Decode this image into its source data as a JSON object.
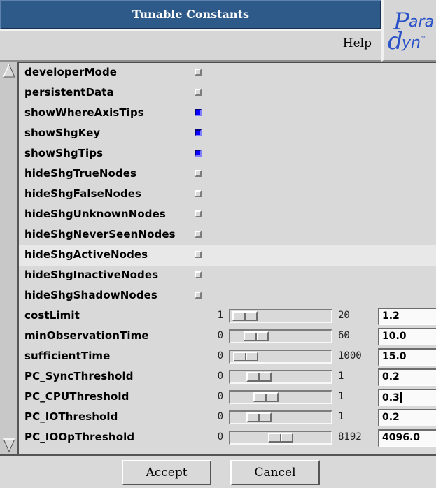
{
  "window": {
    "title": "Tunable Constants"
  },
  "menu": {
    "help_label": "Help"
  },
  "logo": {
    "text_top": "Para",
    "text_bottom": "dyn"
  },
  "booleans": [
    {
      "name": "developerMode",
      "checked": false
    },
    {
      "name": "persistentData",
      "checked": false
    },
    {
      "name": "showWhereAxisTips",
      "checked": true
    },
    {
      "name": "showShgKey",
      "checked": true
    },
    {
      "name": "showShgTips",
      "checked": true
    },
    {
      "name": "hideShgTrueNodes",
      "checked": false
    },
    {
      "name": "hideShgFalseNodes",
      "checked": false
    },
    {
      "name": "hideShgUnknownNodes",
      "checked": false
    },
    {
      "name": "hideShgNeverSeenNodes",
      "checked": false
    },
    {
      "name": "hideShgActiveNodes",
      "checked": false,
      "highlighted": true
    },
    {
      "name": "hideShgInactiveNodes",
      "checked": false
    },
    {
      "name": "hideShgShadowNodes",
      "checked": false
    }
  ],
  "floats": [
    {
      "name": "costLimit",
      "min": "1",
      "max": "20",
      "value": "1.2"
    },
    {
      "name": "minObservationTime",
      "min": "0",
      "max": "60",
      "value": "10.0"
    },
    {
      "name": "sufficientTime",
      "min": "0",
      "max": "1000",
      "value": "15.0"
    },
    {
      "name": "PC_SyncThreshold",
      "min": "0",
      "max": "1",
      "value": "0.2"
    },
    {
      "name": "PC_CPUThreshold",
      "min": "0",
      "max": "1",
      "value": "0.3",
      "focused": true
    },
    {
      "name": "PC_IOThreshold",
      "min": "0",
      "max": "1",
      "value": "0.2"
    },
    {
      "name": "PC_IOOpThreshold",
      "min": "0",
      "max": "8192",
      "value": "4096.0"
    }
  ],
  "buttons": {
    "accept_label": "Accept",
    "cancel_label": "Cancel"
  },
  "colors": {
    "title_bg": "#2e5a8a",
    "checked": "#0a00ff",
    "logo": "#2a52c8"
  }
}
